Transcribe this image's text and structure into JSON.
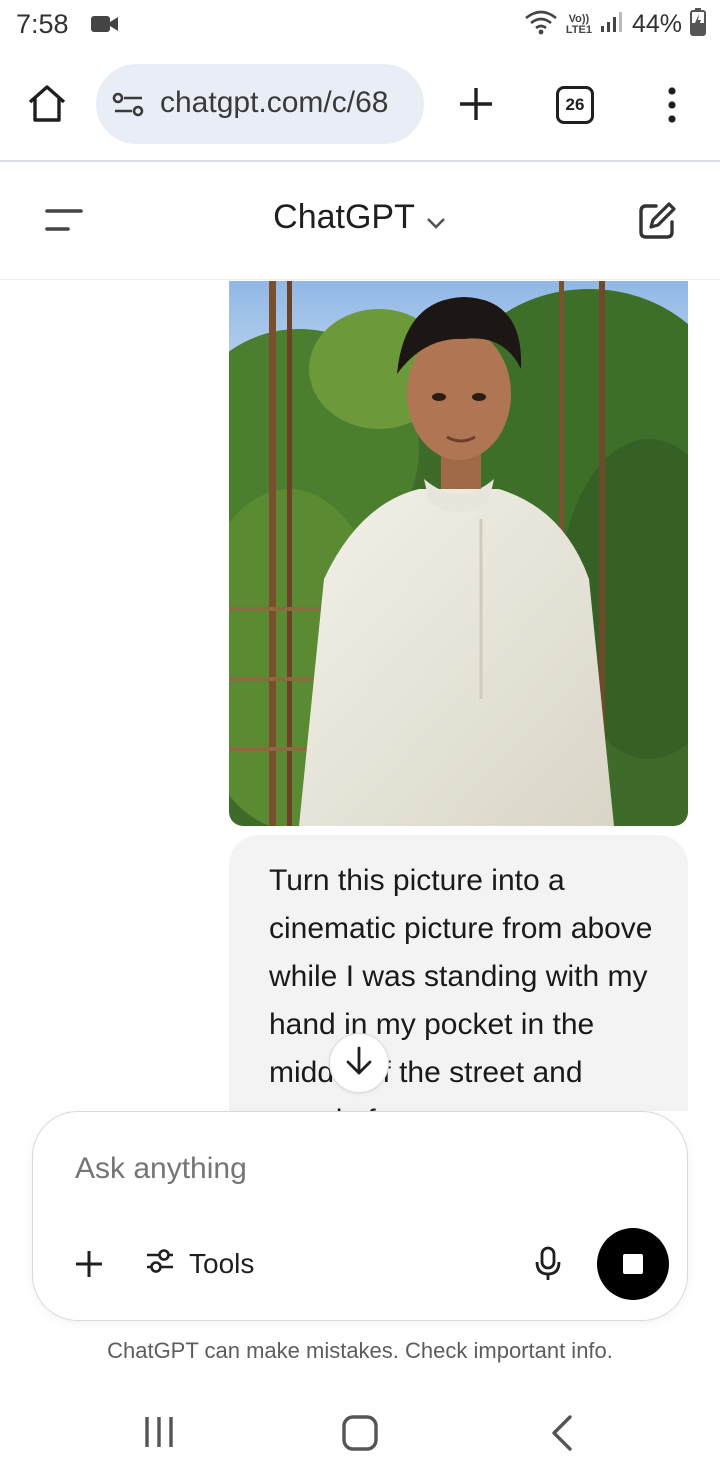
{
  "status_bar": {
    "time": "7:58",
    "network_label_top": "Vo))",
    "network_label_bottom": "LTE1",
    "battery": "44%"
  },
  "browser": {
    "url": "chatgpt.com/c/68",
    "tab_count": "26"
  },
  "header": {
    "title": "ChatGPT"
  },
  "chat": {
    "user_message": "Turn this picture into a cinematic picture from above while I was standing with my hand in my pocket in the middle of the street and people f"
  },
  "composer": {
    "placeholder": "Ask anything",
    "tools_label": "Tools"
  },
  "footer": {
    "disclaimer": "ChatGPT can make mistakes. Check important info."
  },
  "colors": {
    "url_pill": "#e9eef6",
    "bubble": "#f3f3f3",
    "stop_button": "#000000"
  },
  "icons": [
    "video-camera-icon",
    "wifi-icon",
    "signal-icon",
    "battery-icon",
    "home-icon",
    "site-settings-icon",
    "plus-icon",
    "tab-switcher-icon",
    "more-vert-icon",
    "sidebar-menu-icon",
    "chevron-down-icon",
    "new-chat-icon",
    "arrow-down-icon",
    "tools-sliders-icon",
    "mic-icon",
    "stop-icon",
    "recents-icon",
    "nav-home-icon",
    "back-icon"
  ]
}
